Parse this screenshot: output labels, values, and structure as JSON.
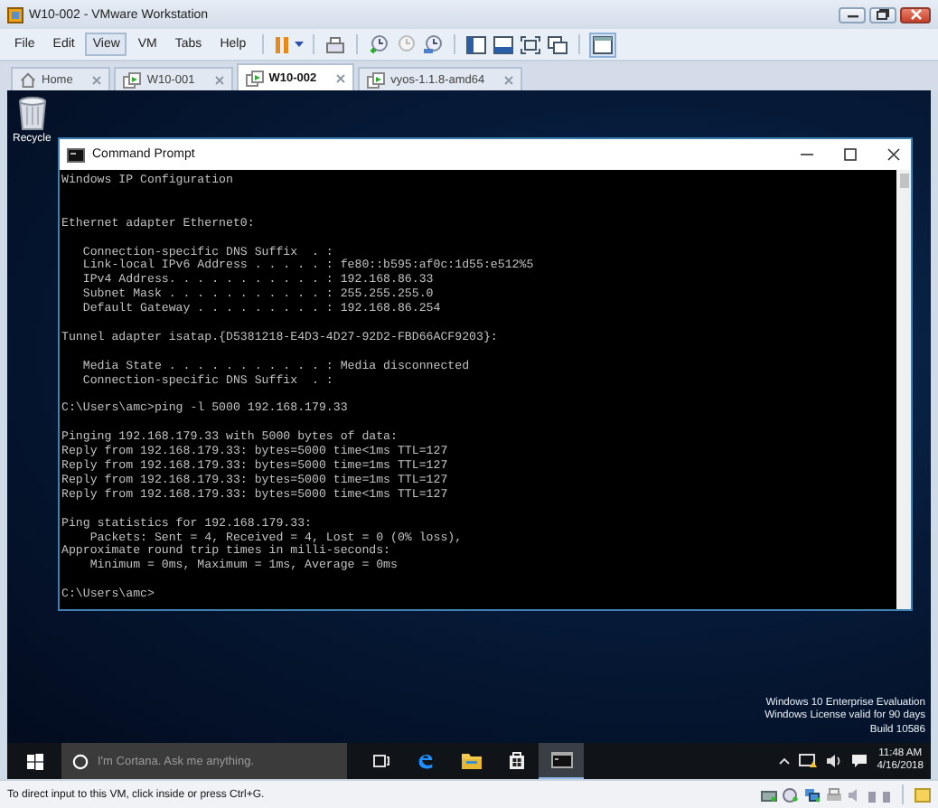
{
  "window": {
    "title": "W10-002 - VMware Workstation"
  },
  "menu": [
    {
      "label": "File",
      "selected": false
    },
    {
      "label": "Edit",
      "selected": false
    },
    {
      "label": "View",
      "selected": true
    },
    {
      "label": "VM",
      "selected": false
    },
    {
      "label": "Tabs",
      "selected": false
    },
    {
      "label": "Help",
      "selected": false
    }
  ],
  "tabs": [
    {
      "label": "Home",
      "kind": "home",
      "selected": false
    },
    {
      "label": "W10-001",
      "kind": "vm",
      "selected": false
    },
    {
      "label": "W10-002",
      "kind": "vm",
      "selected": true
    },
    {
      "label": "vyos-1.1.8-amd64",
      "kind": "vm",
      "selected": false
    }
  ],
  "desktop": {
    "icon_label": "Recycle",
    "console": {
      "title": "Command Prompt",
      "blocks": [
        {
          "lines": [
            "Windows IP Configuration"
          ]
        },
        {
          "lines": [
            "Ethernet adapter Ethernet0:"
          ]
        },
        {
          "lines": [
            "   Connection-specific DNS Suffix  . :",
            "   Link-local IPv6 Address . . . . . : fe80::b595:af0c:1d55:e512%5",
            "   IPv4 Address. . . . . . . . . . . : 192.168.86.33",
            "   Subnet Mask . . . . . . . . . . . : 255.255.255.0",
            "   Default Gateway . . . . . . . . . : 192.168.86.254"
          ]
        },
        {
          "lines": [
            "Tunnel adapter isatap.{D5381218-E4D3-4D27-92D2-FBD66ACF9203}:"
          ]
        },
        {
          "lines": [
            "   Media State . . . . . . . . . . . : Media disconnected",
            "   Connection-specific DNS Suffix  . :"
          ]
        },
        {
          "lines": [
            "C:\\Users\\amc>ping -l 5000 192.168.179.33"
          ]
        },
        {
          "lines": [
            "Pinging 192.168.179.33 with 5000 bytes of data:",
            "Reply from 192.168.179.33: bytes=5000 time<1ms TTL=127",
            "Reply from 192.168.179.33: bytes=5000 time=1ms TTL=127",
            "Reply from 192.168.179.33: bytes=5000 time=1ms TTL=127",
            "Reply from 192.168.179.33: bytes=5000 time<1ms TTL=127"
          ]
        },
        {
          "lines": [
            "Ping statistics for 192.168.179.33:",
            "    Packets: Sent = 4, Received = 4, Lost = 0 (0% loss),",
            "Approximate round trip times in milli-seconds:",
            "    Minimum = 0ms, Maximum = 1ms, Average = 0ms"
          ]
        },
        {
          "lines": [
            "C:\\Users\\amc>"
          ]
        }
      ]
    },
    "evaluation_notice": [
      "Windows 10 Enterprise Evaluation",
      "Windows License valid for 90 days",
      "Build 10586"
    ]
  },
  "taskbar": {
    "search": {
      "placeholder": "I'm Cortana. Ask me anything."
    },
    "apps": [
      {
        "kind": "task-view",
        "active": false
      },
      {
        "kind": "edge",
        "active": false
      },
      {
        "kind": "explorer",
        "active": false
      },
      {
        "kind": "store",
        "active": false
      },
      {
        "kind": "console",
        "active": true
      }
    ],
    "time": "11:48 AM",
    "date": "4/16/2018"
  },
  "status_bar": {
    "message": "To direct input to this VM, click inside or press Ctrl+G."
  }
}
